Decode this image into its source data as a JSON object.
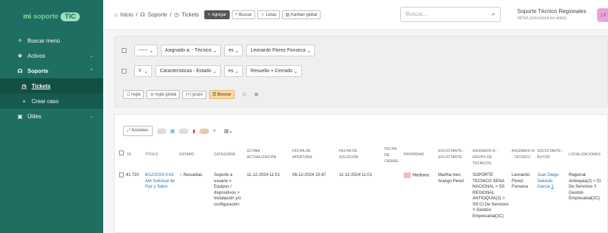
{
  "brand": {
    "mi": "mi",
    "sop": "soporte",
    "tic": "TIC"
  },
  "sidebar": {
    "items": [
      {
        "icon": "search-icon",
        "label": "Buscar menú"
      },
      {
        "icon": "box-icon",
        "label": "Activos"
      },
      {
        "icon": "headset-icon",
        "label": "Soporte"
      }
    ],
    "sub": [
      {
        "icon": "ticket-icon",
        "label": "Tickets"
      },
      {
        "icon": "plus-icon",
        "label": "Crear caso"
      }
    ],
    "utiles": "Útiles"
  },
  "header": {
    "crumbs": [
      "Inicio",
      "Soporte",
      "Tickets"
    ],
    "add": "Agregar",
    "buscar": "Buscar",
    "listas": "Listas",
    "kanban": "Kanban global",
    "search_placeholder": "Buscar...",
    "entity": "Soporte Técnico Regionales",
    "entity_sub": "SENA (estructura en árbol)",
    "avatar": "LF"
  },
  "criteria": {
    "r1": [
      "------",
      "Asignado a: - Técnico",
      "es",
      "Leonardo Florez Fonseca"
    ],
    "r2": [
      "Y",
      "Características - Estado",
      "es",
      "Resuelto + Cerrado"
    ],
    "btns": [
      "regla",
      "regla global",
      "grupo",
      "Buscar"
    ]
  },
  "results": {
    "acciones": "Acciones",
    "headers": [
      "ID",
      "TÍTULO",
      "ESTADO",
      "CATEGORÍA",
      "ÚLTIMA ACTUALIZACIÓN",
      "FECHA DE APERTURA",
      "FECHA DE SOLUCIÓN",
      "FECHA DE CIERRE",
      "PRIORIDAD",
      "SOLICITANTE - SOLICITANTE",
      "ASIGNADO A: - GRUPO DE TÉCNICOS",
      "ASIGNADO A: - TÉCNICO",
      "SOLICITANTE - AUTOR",
      "LOCALIZACIONES"
    ],
    "row": {
      "id": "41 720",
      "title": "6/12/2024 9:43 AM Solicitud de Paz y Salvo",
      "status": "Resueltas",
      "category": "Soporte a usuario > Equipos / dispositivos > Instalación y/o configuración",
      "updated": "11-12-2024 11:01",
      "opened": "06-12-2024 10:47",
      "solved": "11-12-2024 11:01",
      "closed": "",
      "priority": "Mediana",
      "requester": "Martha Ines Arango Perez",
      "group": "SOPORTE TECNICO SENA NACIONAL > SS REGIONAL ANTIOQUIA(2) > SS Ct De Servicios Y Gestión Empresarial(2C)",
      "tech": "Leonardo Florez Fonseca",
      "author": "Juan Diego Salcedo García",
      "author_count": "1",
      "location": "Regional Antioquia(2) > Ct De Servicios Y Gestión Empresarial(2C)"
    }
  }
}
